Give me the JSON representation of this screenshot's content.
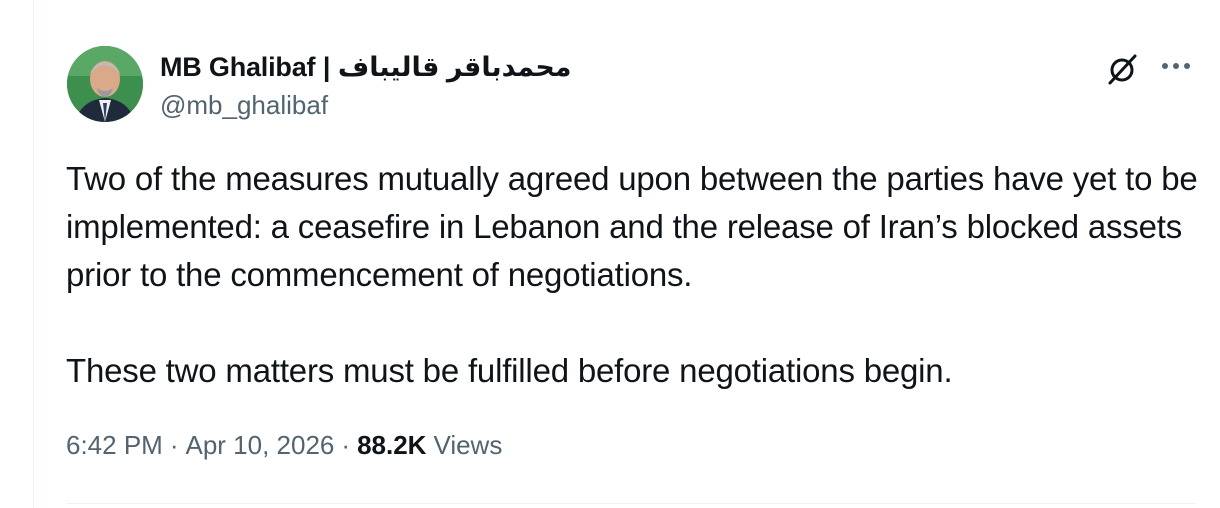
{
  "author": {
    "display_name": "محمدباقر قالیباف | MB Ghalibaf",
    "handle": "@mb_ghalibaf"
  },
  "tweet": {
    "paragraphs": [
      "Two of the measures mutually agreed upon between the parties have yet to be implemented: a ceasefire in Lebanon and the release of Iran’s blocked assets prior to the commencement of negotiations.",
      "These two matters must be fulfilled before negotiations begin."
    ]
  },
  "meta": {
    "time": "6:42 PM",
    "separator": "·",
    "date": "Apr 10, 2026",
    "views_count": "88.2K",
    "views_label": "Views"
  },
  "icons": {
    "grok": "grok-icon",
    "more": "more-options-icon"
  },
  "colors": {
    "primary_text": "#0f1419",
    "secondary_text": "#536471",
    "border": "#eff3f4"
  }
}
